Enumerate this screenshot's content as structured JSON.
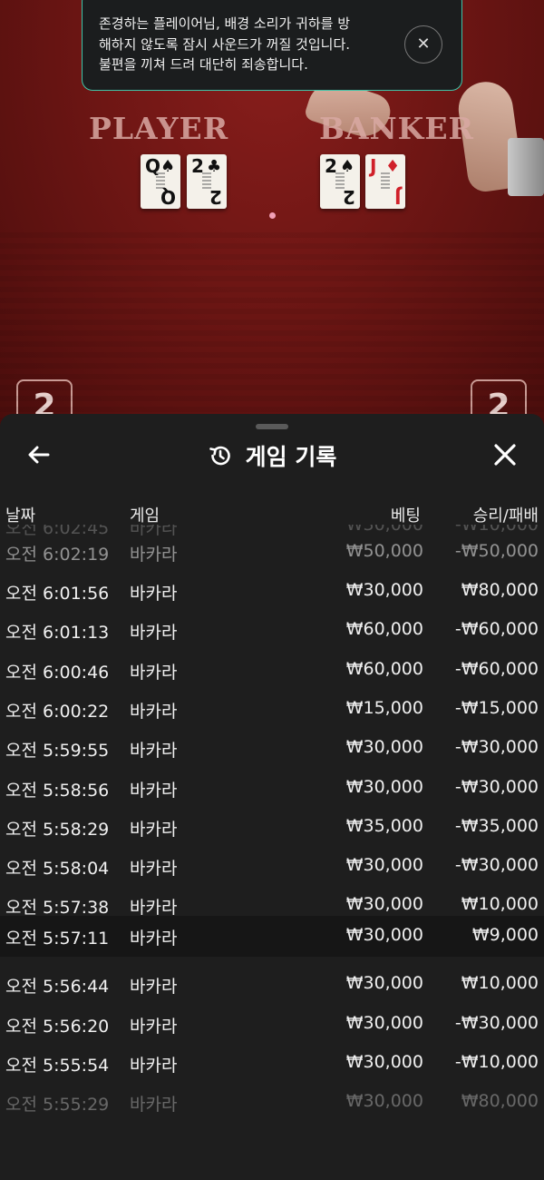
{
  "toast": {
    "message_line1": "존경하는 플레이어님, 배경 소리가 귀하를 방",
    "message_line2": "해하지 않도록 잠시 사운드가 꺼질 것입니다.",
    "message_line3": "불편을 끼쳐 드려 대단히 죄송합니다.",
    "close_symbol": "✕"
  },
  "table": {
    "player_label": "PLAYER",
    "banker_label": "BANKER",
    "player_cards": [
      {
        "rank": "Q",
        "suit": "♠"
      },
      {
        "rank": "2",
        "suit": "♣"
      }
    ],
    "banker_cards": [
      {
        "rank": "2",
        "suit": "♠"
      },
      {
        "rank": "J",
        "suit": "♦"
      }
    ],
    "left_score": "2",
    "right_score": "2"
  },
  "sheet": {
    "title": "게임 기록",
    "columns": {
      "date": "날짜",
      "game": "게임",
      "bet": "베팅",
      "win_loss": "승리/패배"
    },
    "rows": [
      {
        "time": "오전 6:02:45",
        "game": "바카라",
        "bet": "₩30,000",
        "result": "-₩10,000"
      },
      {
        "time": "오전 6:02:19",
        "game": "바카라",
        "bet": "₩50,000",
        "result": "-₩50,000"
      },
      {
        "time": "오전 6:01:56",
        "game": "바카라",
        "bet": "₩30,000",
        "result": "₩80,000"
      },
      {
        "time": "오전 6:01:13",
        "game": "바카라",
        "bet": "₩60,000",
        "result": "-₩60,000"
      },
      {
        "time": "오전 6:00:46",
        "game": "바카라",
        "bet": "₩60,000",
        "result": "-₩60,000"
      },
      {
        "time": "오전 6:00:22",
        "game": "바카라",
        "bet": "₩15,000",
        "result": "-₩15,000"
      },
      {
        "time": "오전 5:59:55",
        "game": "바카라",
        "bet": "₩30,000",
        "result": "-₩30,000"
      },
      {
        "time": "오전 5:58:56",
        "game": "바카라",
        "bet": "₩30,000",
        "result": "-₩30,000"
      },
      {
        "time": "오전 5:58:29",
        "game": "바카라",
        "bet": "₩35,000",
        "result": "-₩35,000"
      },
      {
        "time": "오전 5:58:04",
        "game": "바카라",
        "bet": "₩30,000",
        "result": "-₩30,000"
      },
      {
        "time": "오전 5:57:38",
        "game": "바카라",
        "bet": "₩30,000",
        "result": "₩10,000"
      },
      {
        "time": "오전 5:57:11",
        "game": "바카라",
        "bet": "₩30,000",
        "result": "₩9,000"
      },
      {
        "time": "오전 5:56:44",
        "game": "바카라",
        "bet": "₩30,000",
        "result": "₩10,000"
      },
      {
        "time": "오전 5:56:20",
        "game": "바카라",
        "bet": "₩30,000",
        "result": "-₩30,000"
      },
      {
        "time": "오전 5:55:54",
        "game": "바카라",
        "bet": "₩30,000",
        "result": "-₩10,000"
      },
      {
        "time": "오전 5:55:29",
        "game": "바카라",
        "bet": "₩30,000",
        "result": "₩80,000"
      }
    ]
  }
}
